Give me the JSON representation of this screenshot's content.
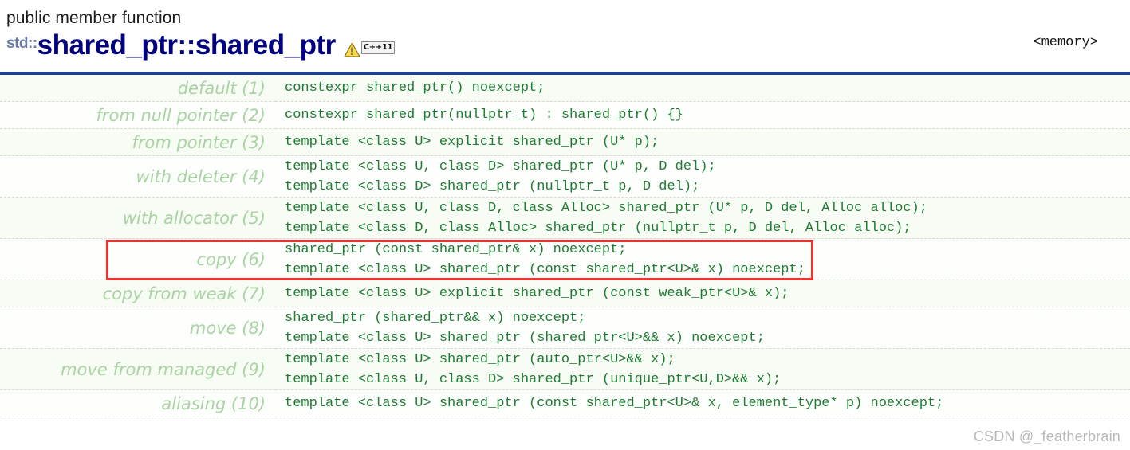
{
  "header": {
    "kind": "public member function",
    "namespace_prefix": "std::",
    "title": "shared_ptr::shared_ptr",
    "warning_icon": "warning-triangle-icon",
    "cpp_badge": "C++11",
    "header_include": "<memory>",
    "rule_color": "#20408c"
  },
  "colors": {
    "label": "#a9d3a2",
    "code": "#1f7a33",
    "title": "#000080",
    "namespace": "#6b7ba6",
    "highlight": "#f5312e",
    "row_bg_a": "#f7fcf5",
    "row_bg_b": "#fdfffc"
  },
  "rows": [
    {
      "label": "default (1)",
      "lines": [
        "constexpr shared_ptr() noexcept;"
      ],
      "highlighted": false
    },
    {
      "label": "from null pointer (2)",
      "lines": [
        "constexpr shared_ptr(nullptr_t) : shared_ptr() {}"
      ],
      "highlighted": false
    },
    {
      "label": "from pointer (3)",
      "lines": [
        "template <class U> explicit shared_ptr (U* p);"
      ],
      "highlighted": false
    },
    {
      "label": "with deleter (4)",
      "lines": [
        "template <class U, class D> shared_ptr (U* p, D del);",
        "template <class D> shared_ptr (nullptr_t p, D del);"
      ],
      "highlighted": true
    },
    {
      "label": "with allocator (5)",
      "lines": [
        "template <class U, class D, class Alloc> shared_ptr (U* p, D del, Alloc alloc);",
        "template <class D, class Alloc> shared_ptr (nullptr_t p, D del, Alloc alloc);"
      ],
      "highlighted": false
    },
    {
      "label": "copy (6)",
      "lines": [
        "shared_ptr (const shared_ptr& x) noexcept;",
        "template <class U> shared_ptr (const shared_ptr<U>& x) noexcept;"
      ],
      "highlighted": false
    },
    {
      "label": "copy from weak (7)",
      "lines": [
        "template <class U> explicit shared_ptr (const weak_ptr<U>& x);"
      ],
      "highlighted": false
    },
    {
      "label": "move (8)",
      "lines": [
        "shared_ptr (shared_ptr&& x) noexcept;",
        "template <class U> shared_ptr (shared_ptr<U>&& x) noexcept;"
      ],
      "highlighted": false
    },
    {
      "label": "move from managed (9)",
      "lines": [
        "template <class U> shared_ptr (auto_ptr<U>&& x);",
        "template <class U, class D> shared_ptr (unique_ptr<U,D>&& x);"
      ],
      "highlighted": false
    },
    {
      "label": "aliasing (10)",
      "lines": [
        "template <class U> shared_ptr (const shared_ptr<U>& x, element_type* p) noexcept;"
      ],
      "highlighted": false
    }
  ],
  "watermark": "CSDN @_featherbrain"
}
